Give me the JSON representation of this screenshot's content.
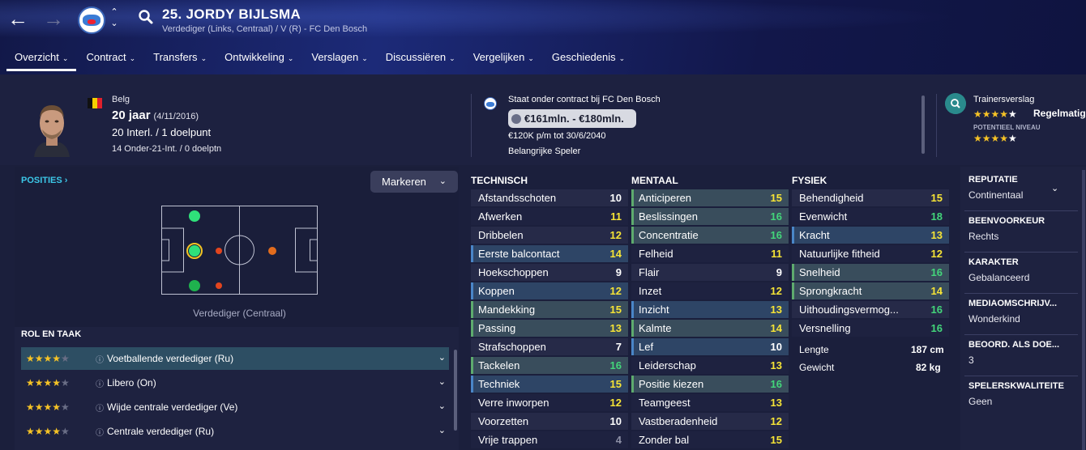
{
  "header": {
    "title": "25. JORDY BIJLSMA",
    "subtitle": "Verdediger (Links, Centraal) / V (R) - FC Den Bosch",
    "back_icon": "arrow-left-icon",
    "forward_icon": "arrow-right-icon",
    "search_icon": "search-icon",
    "updown_up": "⌃",
    "updown_down": "⌄"
  },
  "tabs": [
    {
      "label": "Overzicht",
      "active": true
    },
    {
      "label": "Contract"
    },
    {
      "label": "Transfers"
    },
    {
      "label": "Ontwikkeling"
    },
    {
      "label": "Verslagen"
    },
    {
      "label": "Discussiëren"
    },
    {
      "label": "Vergelijken"
    },
    {
      "label": "Geschiedenis"
    }
  ],
  "player": {
    "nationality": "Belg",
    "age": "20 jaar",
    "dob": "(4/11/2016)",
    "caps": "20 Interl. / 1 doelpunt",
    "u21": "14 Onder-21-Int. / 0 doelptn",
    "flag_colors": [
      "#111111",
      "#f5d000",
      "#e0202c"
    ]
  },
  "contract": {
    "status": "Staat onder contract bij FC Den Bosch",
    "value": "€161mln. - €180mln.",
    "wage": "€120K p/m tot 30/6/2040",
    "role": "Belangrijke Speler"
  },
  "trainer": {
    "title": "Trainersverslag",
    "current_stars": 4,
    "current_label": "Regelmatig",
    "potential_label": "POTENTIEEL NIVEAU",
    "potential_stars": 5
  },
  "positions": {
    "title": "POSITIES ›",
    "mark_button": "Markeren",
    "caption": "Verdediger (Centraal)"
  },
  "roles": {
    "title": "ROL EN TAAK",
    "items": [
      {
        "label": "Voetballende verdediger (Ru)",
        "stars": 4,
        "selected": true
      },
      {
        "label": "Libero (On)",
        "stars": 4
      },
      {
        "label": "Wijde centrale verdediger (Ve)",
        "stars": 4
      },
      {
        "label": "Centrale verdediger (Ru)",
        "stars": 4
      }
    ],
    "info_icon": "ⓘ"
  },
  "technical": {
    "title": "TECHNISCH",
    "rows": [
      {
        "name": "Afstandsschoten",
        "value": "10",
        "hl": ""
      },
      {
        "name": "Afwerken",
        "value": "11",
        "hl": ""
      },
      {
        "name": "Dribbelen",
        "value": "12",
        "hl": ""
      },
      {
        "name": "Eerste balcontact",
        "value": "14",
        "hl": "b"
      },
      {
        "name": "Hoekschoppen",
        "value": "9",
        "hl": ""
      },
      {
        "name": "Koppen",
        "value": "12",
        "hl": "b"
      },
      {
        "name": "Mandekking",
        "value": "15",
        "hl": "g"
      },
      {
        "name": "Passing",
        "value": "13",
        "hl": "g"
      },
      {
        "name": "Strafschoppen",
        "value": "7",
        "hl": ""
      },
      {
        "name": "Tackelen",
        "value": "16",
        "hl": "g"
      },
      {
        "name": "Techniek",
        "value": "15",
        "hl": "b"
      },
      {
        "name": "Verre inworpen",
        "value": "12",
        "hl": ""
      },
      {
        "name": "Voorzetten",
        "value": "10",
        "hl": ""
      },
      {
        "name": "Vrije trappen",
        "value": "4",
        "hl": ""
      }
    ]
  },
  "mental": {
    "title": "MENTAAL",
    "rows": [
      {
        "name": "Anticiperen",
        "value": "15",
        "hl": "g"
      },
      {
        "name": "Beslissingen",
        "value": "16",
        "hl": "g"
      },
      {
        "name": "Concentratie",
        "value": "16",
        "hl": "g"
      },
      {
        "name": "Felheid",
        "value": "11",
        "hl": ""
      },
      {
        "name": "Flair",
        "value": "9",
        "hl": ""
      },
      {
        "name": "Inzet",
        "value": "12",
        "hl": ""
      },
      {
        "name": "Inzicht",
        "value": "13",
        "hl": "b"
      },
      {
        "name": "Kalmte",
        "value": "14",
        "hl": "g"
      },
      {
        "name": "Lef",
        "value": "10",
        "hl": "b"
      },
      {
        "name": "Leiderschap",
        "value": "13",
        "hl": ""
      },
      {
        "name": "Positie kiezen",
        "value": "16",
        "hl": "g"
      },
      {
        "name": "Teamgeest",
        "value": "13",
        "hl": ""
      },
      {
        "name": "Vastberadenheid",
        "value": "12",
        "hl": ""
      },
      {
        "name": "Zonder bal",
        "value": "15",
        "hl": ""
      }
    ]
  },
  "physical": {
    "title": "FYSIEK",
    "rows": [
      {
        "name": "Behendigheid",
        "value": "15",
        "hl": ""
      },
      {
        "name": "Evenwicht",
        "value": "18",
        "hl": ""
      },
      {
        "name": "Kracht",
        "value": "13",
        "hl": "b"
      },
      {
        "name": "Natuurlijke fitheid",
        "value": "12",
        "hl": ""
      },
      {
        "name": "Snelheid",
        "value": "16",
        "hl": "g"
      },
      {
        "name": "Sprongkracht",
        "value": "14",
        "hl": "g"
      },
      {
        "name": "Uithoudingsvermog...",
        "value": "16",
        "hl": ""
      },
      {
        "name": "Versnelling",
        "value": "16",
        "hl": ""
      }
    ],
    "height_label": "Lengte",
    "height": "187 cm",
    "weight_label": "Gewicht",
    "weight": "82 kg"
  },
  "info": [
    {
      "h": "REPUTATIE",
      "b": "Continentaal"
    },
    {
      "h": "BEENVOORKEUR",
      "b": "Rechts"
    },
    {
      "h": "KARAKTER",
      "b": "Gebalanceerd"
    },
    {
      "h": "MEDIAOMSCHRIJV...",
      "b": "Wonderkind"
    },
    {
      "h": "BEOORD. ALS DOE...",
      "b": "3"
    },
    {
      "h": "SPELERSKWALITEITE",
      "b": "Geen"
    }
  ]
}
